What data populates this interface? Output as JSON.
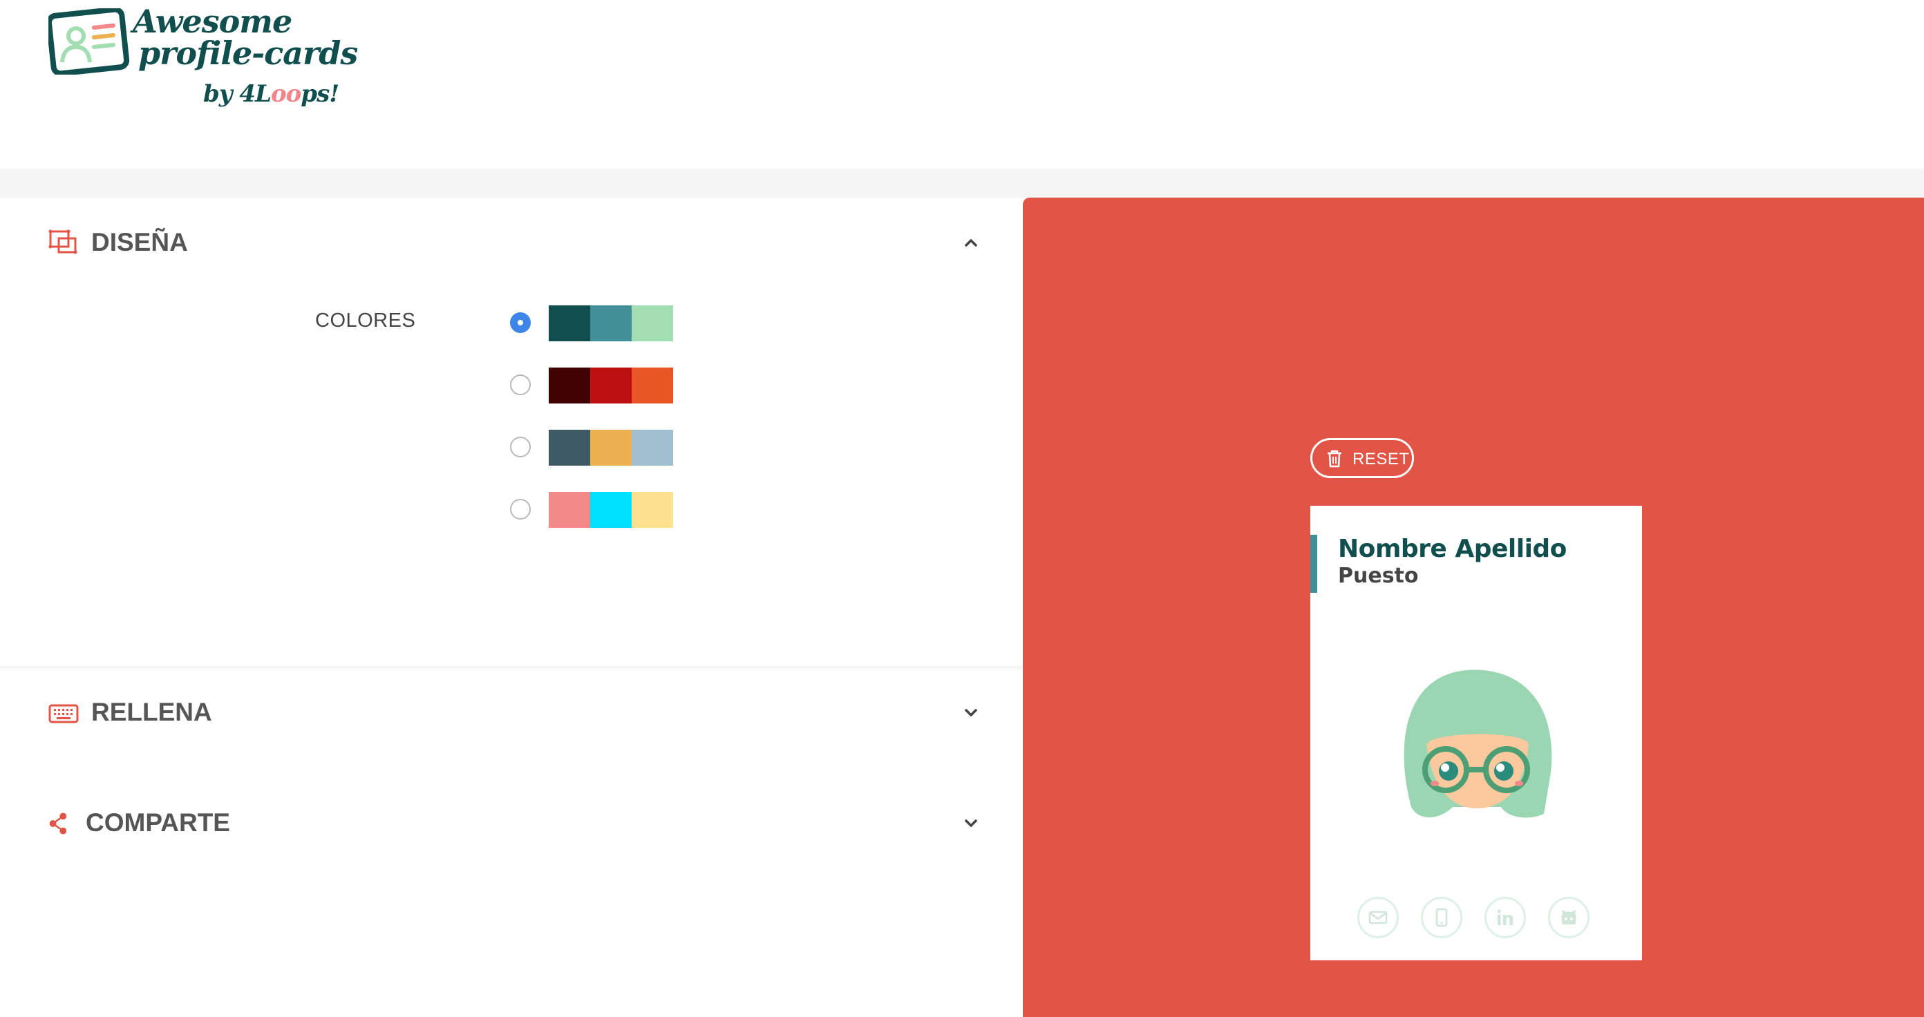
{
  "header": {
    "logo_line1": "Awesome",
    "logo_line2": "profile-cards",
    "logo_by_prefix": "by 4L",
    "logo_by_oo": "oo",
    "logo_by_suffix": "ps!"
  },
  "sections": {
    "design": {
      "title": "DISEÑA",
      "expanded": true,
      "icon": "design-icon"
    },
    "fill": {
      "title": "RELLENA",
      "expanded": false,
      "icon": "keyboard-icon"
    },
    "share": {
      "title": "COMPARTE",
      "expanded": false,
      "icon": "share-icon"
    }
  },
  "colors": {
    "label": "COLORES",
    "selected": 0,
    "palettes": [
      [
        "#114e4e",
        "#438f98",
        "#a2deb2"
      ],
      [
        "#420101",
        "#bd1010",
        "#e95626"
      ],
      [
        "#3e5b65",
        "#eab052",
        "#a0c0cf"
      ],
      [
        "#f4898a",
        "#00e1ff",
        "#fee190"
      ]
    ]
  },
  "preview": {
    "background": "#e25446",
    "reset_label": "RESET",
    "card": {
      "name": "Nombre Apellido",
      "job": "Puesto",
      "accent": "#438f98"
    },
    "social_icons": [
      "mail-icon",
      "phone-icon",
      "linkedin-icon",
      "github-icon"
    ]
  }
}
